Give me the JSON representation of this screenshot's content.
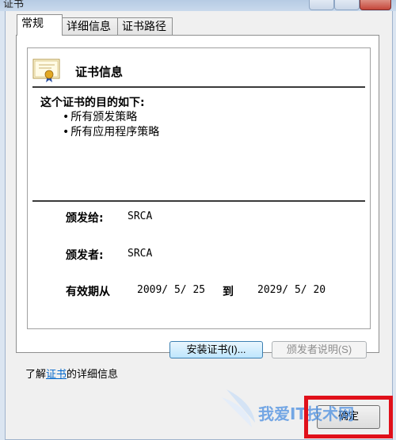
{
  "window": {
    "title": "证书"
  },
  "tabs": [
    {
      "label": "常规",
      "active": true
    },
    {
      "label": "详细信息",
      "active": false
    },
    {
      "label": "证书路径",
      "active": false
    }
  ],
  "cert_info": {
    "title": "证书信息",
    "purpose_heading": "这个证书的目的如下:",
    "purposes": [
      "所有颁发策略",
      "所有应用程序策略"
    ],
    "issued_to_label": "颁发给:",
    "issued_to_value": "SRCA",
    "issued_by_label": "颁发者:",
    "issued_by_value": "SRCA",
    "validity_label": "有效期从",
    "valid_from": "2009/ 5/ 25",
    "to_label": "到",
    "valid_to": "2029/ 5/ 20"
  },
  "buttons": {
    "install": "安装证书(I)...",
    "issuer_statement": "颁发者说明(S)",
    "ok": "确定"
  },
  "learn_more": {
    "prefix": "了解",
    "link": "证书",
    "suffix": "的详细信息"
  },
  "watermark": {
    "text": "我爱IT技术网"
  },
  "colors": {
    "highlight": "#e0101a",
    "link": "#0066cc",
    "watermark": "#4a8ee0"
  },
  "icons": [
    "certificate-icon"
  ]
}
